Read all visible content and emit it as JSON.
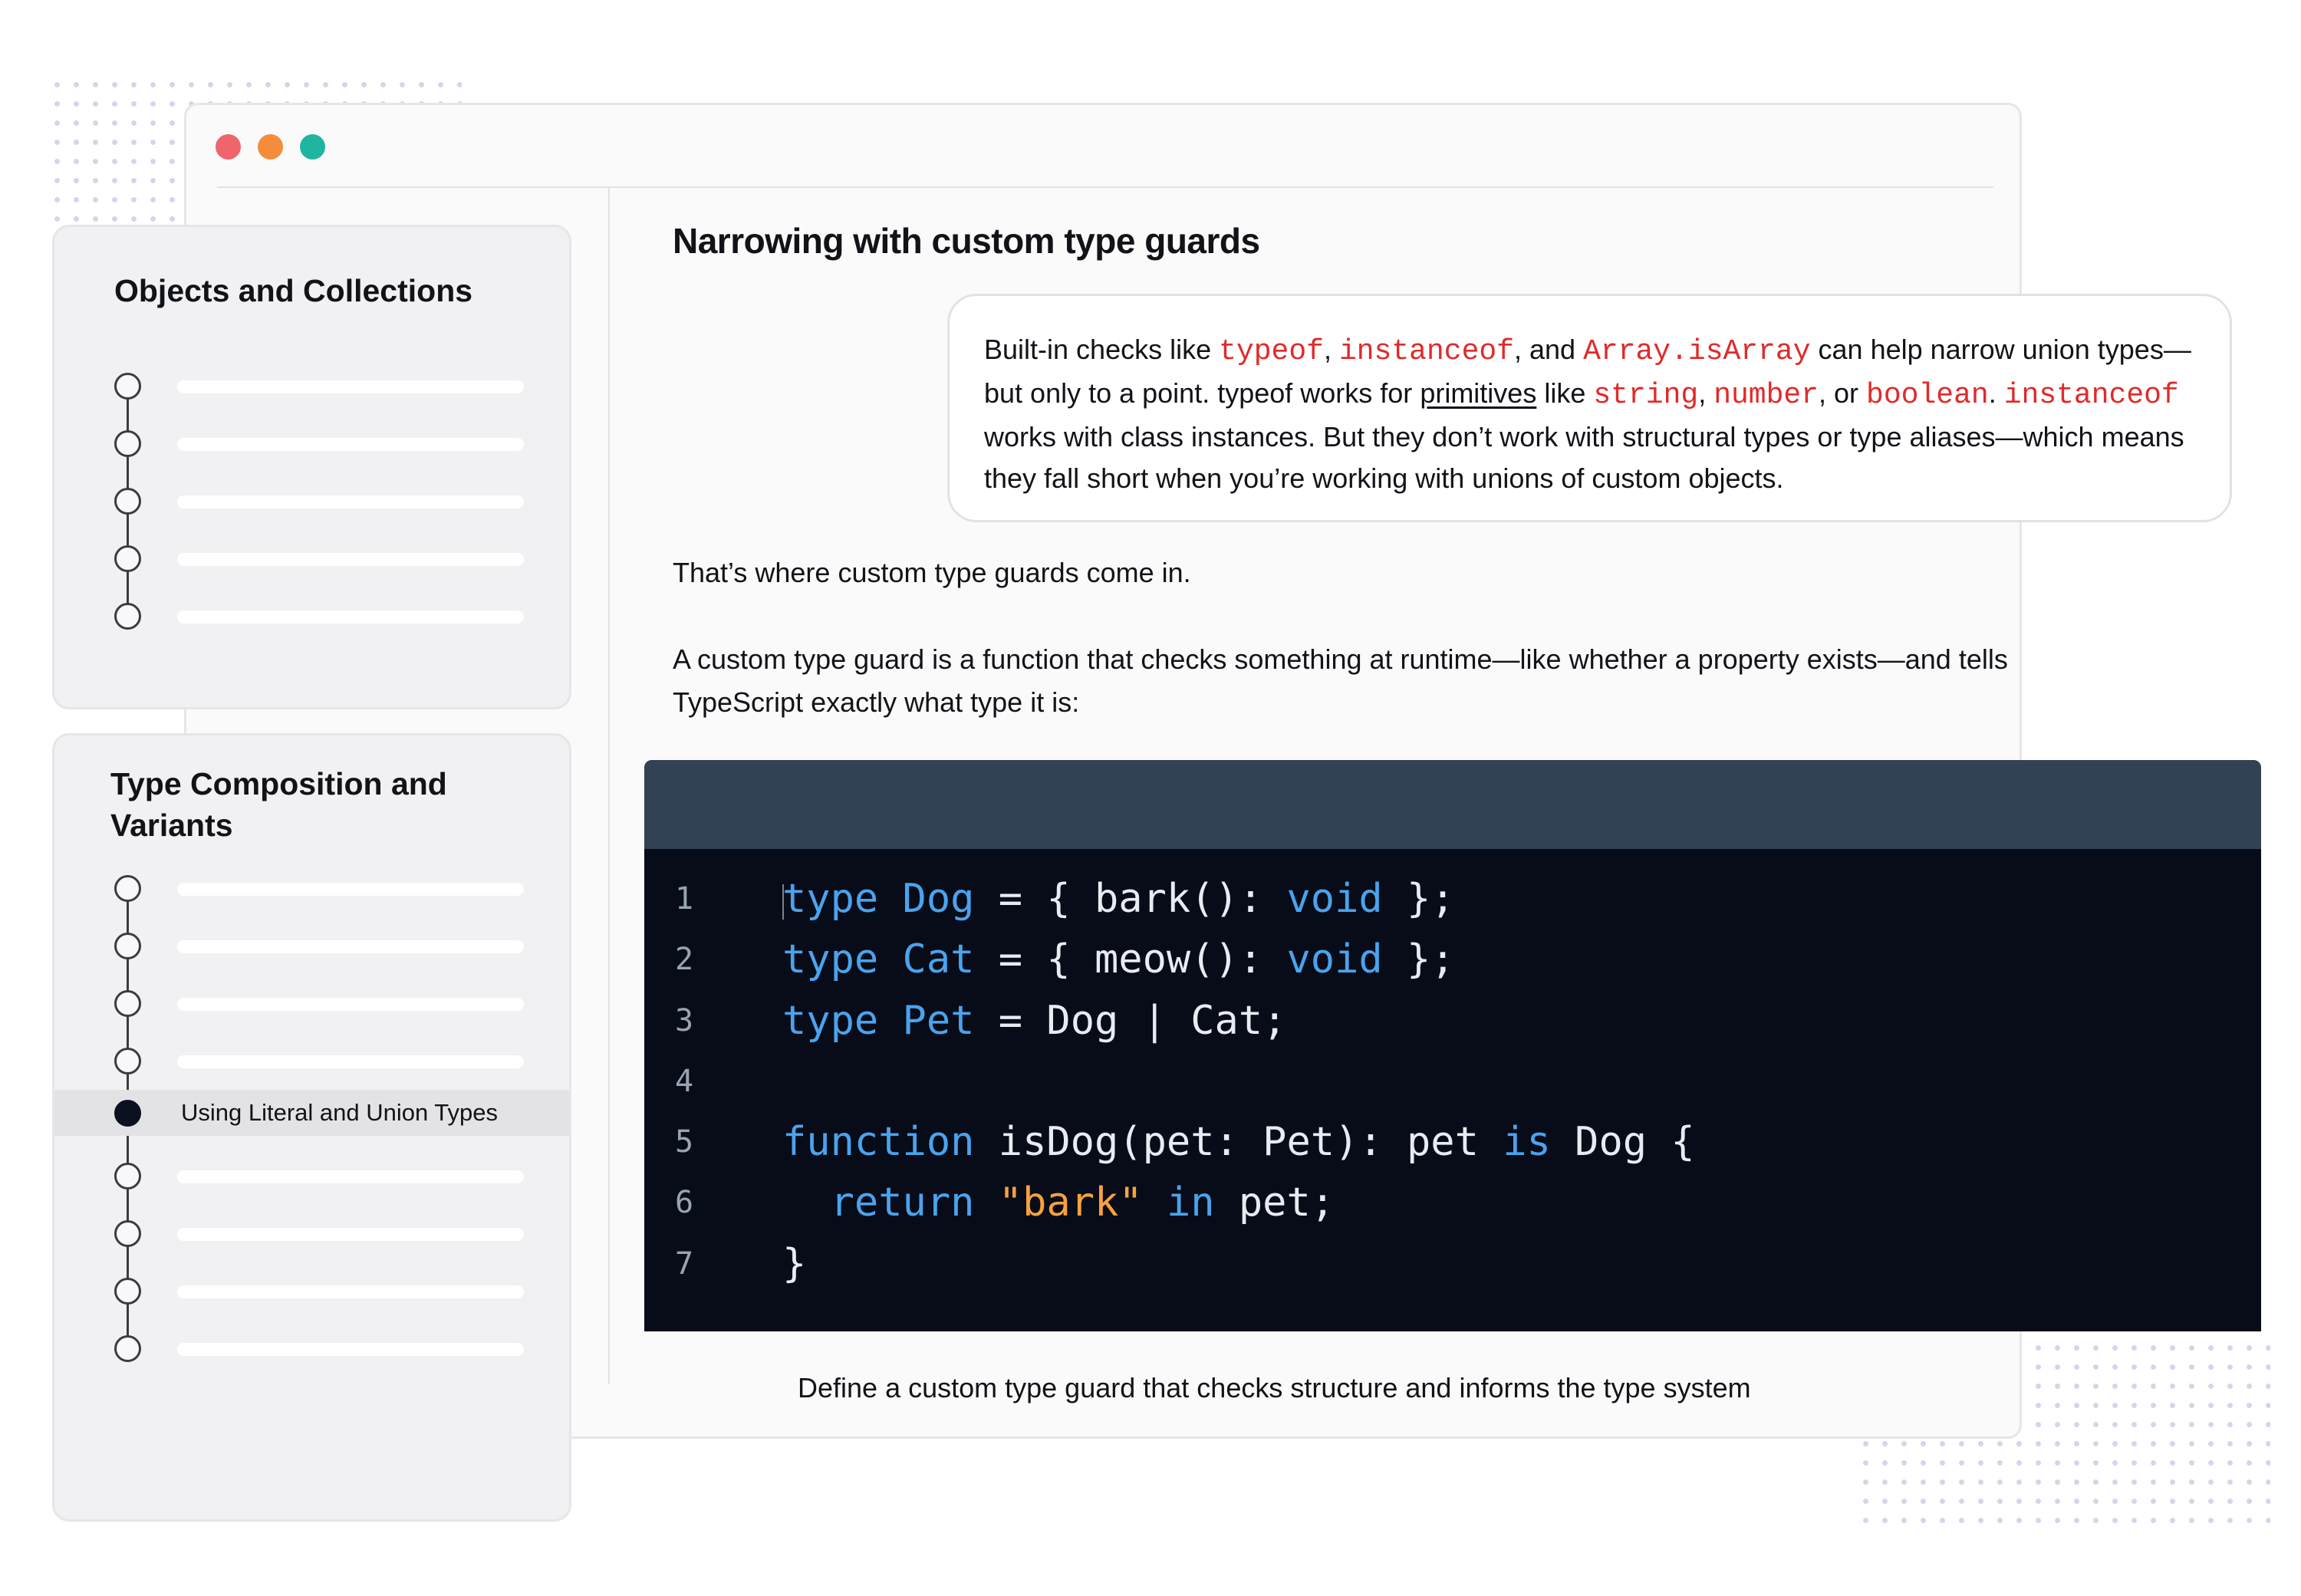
{
  "colors": {
    "traffic_red": "#f0646c",
    "traffic_orange": "#f48c3c",
    "traffic_green": "#1fb5a0",
    "code_background": "#070c18",
    "code_header": "#334155",
    "keyword_blue": "#4aa3ee",
    "string_orange": "#f7a23e",
    "inline_code_red": "#e02a2a"
  },
  "window": {
    "controls": [
      "close-dot",
      "minimize-dot",
      "maximize-dot"
    ]
  },
  "sidebar": {
    "sections": [
      {
        "title": "Objects and Collections",
        "items_count": 5
      },
      {
        "title": "Type Composition and Variants",
        "active_item_label": "Using Literal and Union Types",
        "active_index": 4,
        "items_count": 9
      }
    ]
  },
  "article": {
    "title": "Narrowing with custom type guards",
    "callout": {
      "t1": "Built-in checks like ",
      "c1": "typeof",
      "t2": ", ",
      "c2": "instanceof",
      "t3": ", and ",
      "c3": "Array.isArray",
      "t4": " can help narrow union types—but only to a point. typeof works for ",
      "link": "primitives",
      "t5": " like ",
      "c4": "string",
      "t6": ", ",
      "c5": "number",
      "t7": ", or ",
      "c6": "boolean",
      "t8": ". ",
      "c7": "instanceof",
      "t9": " works with class instances. But they don’t work with structural types or type aliases—which means they fall short when you’re working with unions of custom objects."
    },
    "paragraph_1": "That’s where custom type guards come in.",
    "paragraph_2": "A custom type guard is a function that checks something at runtime—like whether a property exists—and tells TypeScript exactly what type it is:",
    "code": {
      "line_numbers": [
        "1",
        "2",
        "3",
        "4",
        "5",
        "6",
        "7"
      ],
      "lines": [
        [
          {
            "t": "type",
            "k": "kw"
          },
          {
            "t": " "
          },
          {
            "t": "Dog",
            "k": "kw"
          },
          {
            "t": " = { bark(): "
          },
          {
            "t": "void",
            "k": "kw"
          },
          {
            "t": " };"
          }
        ],
        [
          {
            "t": "type",
            "k": "kw"
          },
          {
            "t": " "
          },
          {
            "t": "Cat",
            "k": "kw"
          },
          {
            "t": " = { meow(): "
          },
          {
            "t": "void",
            "k": "kw"
          },
          {
            "t": " };"
          }
        ],
        [
          {
            "t": "type",
            "k": "kw"
          },
          {
            "t": " "
          },
          {
            "t": "Pet",
            "k": "kw"
          },
          {
            "t": " = Dog | Cat;"
          }
        ],
        [],
        [
          {
            "t": "function",
            "k": "kw"
          },
          {
            "t": " isDog(pet: Pet): pet "
          },
          {
            "t": "is",
            "k": "kw"
          },
          {
            "t": " Dog {"
          }
        ],
        [
          {
            "t": "  "
          },
          {
            "t": "return",
            "k": "kw"
          },
          {
            "t": " "
          },
          {
            "t": "\"bark\"",
            "k": "str"
          },
          {
            "t": " "
          },
          {
            "t": "in",
            "k": "kw"
          },
          {
            "t": " pet;"
          }
        ],
        [
          {
            "t": "}"
          }
        ]
      ]
    },
    "caption": "Define a custom type guard that checks structure and informs the type system"
  }
}
